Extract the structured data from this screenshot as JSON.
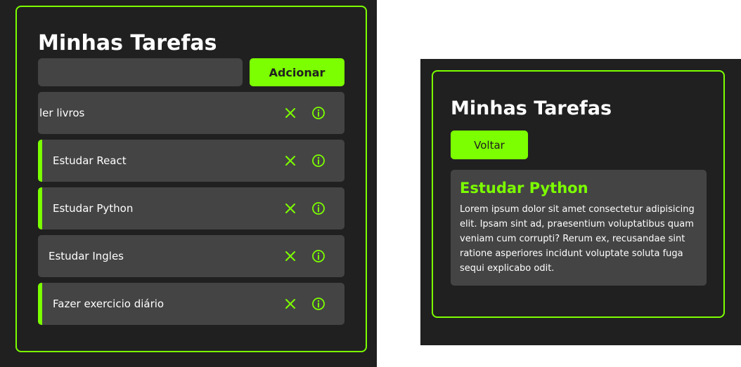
{
  "list_view": {
    "title": "Minhas Tarefas",
    "input": {
      "value": "",
      "placeholder": ""
    },
    "add_button": "Adcionar",
    "tasks": [
      {
        "label": "ler livros",
        "completed": false
      },
      {
        "label": "Estudar React",
        "completed": true
      },
      {
        "label": "Estudar Python",
        "completed": true
      },
      {
        "label": "Estudar Ingles",
        "completed": false
      },
      {
        "label": "Fazer exercicio diário",
        "completed": true
      }
    ],
    "icons": {
      "delete": "close-icon",
      "details": "info-icon"
    }
  },
  "detail_view": {
    "title": "Minhas Tarefas",
    "back_button": "Voltar",
    "task_title": "Estudar Python",
    "task_description": "Lorem ipsum dolor sit amet consectetur adipisicing elit. Ipsam sint ad, praesentium voluptatibus quam veniam cum corrupti? Rerum ex, recusandae sint ratione asperiores incidunt voluptate soluta fuga sequi explicabo odit."
  },
  "colors": {
    "background": "#202020",
    "accent": "#7cff00",
    "surface": "#444444",
    "text": "#ffffff"
  }
}
